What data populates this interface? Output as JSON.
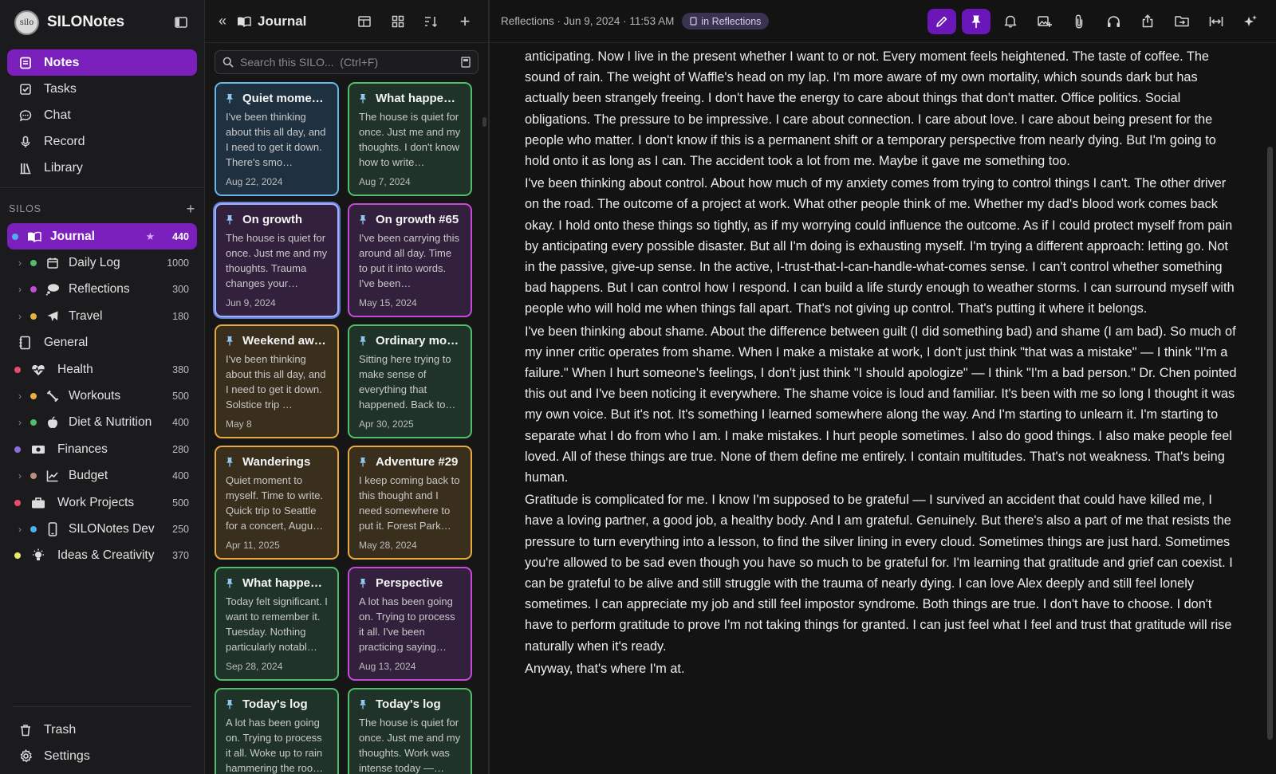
{
  "app": {
    "name": "SILONotes",
    "logo_text": "silo"
  },
  "nav": {
    "items": [
      {
        "label": "Notes",
        "icon": "notes-icon"
      },
      {
        "label": "Tasks",
        "icon": "checkbox-icon"
      },
      {
        "label": "Chat",
        "icon": "chat-icon"
      },
      {
        "label": "Record",
        "icon": "mic-icon"
      },
      {
        "label": "Library",
        "icon": "library-icon"
      }
    ]
  },
  "silos": {
    "heading": "SILOS",
    "items": [
      {
        "name": "Journal",
        "count": "440",
        "dot": "#4ab0f0",
        "icon": "book-icon",
        "starred": true,
        "child": false
      },
      {
        "name": "Daily Log",
        "count": "1000",
        "dot": "#4fbd6b",
        "icon": "calendar-icon",
        "child": true
      },
      {
        "name": "Reflections",
        "count": "300",
        "dot": "#c64ad8",
        "icon": "thought-icon",
        "child": true
      },
      {
        "name": "Travel",
        "count": "180",
        "dot": "#e8b040",
        "icon": "plane-icon",
        "child": true
      },
      {
        "name": "General",
        "count": "",
        "dot": "",
        "icon": "notebook-icon",
        "child": false
      },
      {
        "name": "Health",
        "count": "380",
        "dot": "#e64c6a",
        "icon": "heartbeat-icon",
        "child": false
      },
      {
        "name": "Workouts",
        "count": "500",
        "dot": "#e8b040",
        "icon": "dumbbell-icon",
        "child": true
      },
      {
        "name": "Diet & Nutrition",
        "count": "400",
        "dot": "#4fbd6b",
        "icon": "apple-icon",
        "child": true
      },
      {
        "name": "Finances",
        "count": "280",
        "dot": "#8a6ee0",
        "icon": "money-icon",
        "child": false
      },
      {
        "name": "Budget",
        "count": "400",
        "dot": "#b8927e",
        "icon": "chart-line-icon",
        "child": true
      },
      {
        "name": "Work Projects",
        "count": "500",
        "dot": "#e64c6a",
        "icon": "briefcase-icon",
        "child": false
      },
      {
        "name": "SILONotes Dev",
        "count": "250",
        "dot": "#4ab0f0",
        "icon": "phone-icon",
        "child": true
      },
      {
        "name": "Ideas & Creativity",
        "count": "370",
        "dot": "#e8e86a",
        "icon": "bulb-icon",
        "child": false
      }
    ]
  },
  "footer": {
    "trash": "Trash",
    "settings": "Settings"
  },
  "list": {
    "title": "Journal",
    "search_placeholder": "Search this SILO...  (Ctrl+F)",
    "cards": [
      {
        "title": "Quiet mome…",
        "body": "I've been thinking about this all day, and I need to get it down. There's smo…",
        "date": "Aug 22, 2024",
        "color": "blue"
      },
      {
        "title": "What happen…",
        "body": "The house is quiet for once. Just me and my thoughts. I don't know how to write…",
        "date": "Aug 7, 2024",
        "color": "green"
      },
      {
        "title": "On growth",
        "body": "The house is quiet for once. Just me and my thoughts. Trauma changes your…",
        "date": "Jun 9, 2024",
        "color": "selected"
      },
      {
        "title": "On growth #65",
        "body": "I've been carrying this around all day. Time to put it into words. I've been…",
        "date": "May 15, 2024",
        "color": "purple"
      },
      {
        "title": "Weekend aw…",
        "body": "I've been thinking about this all day, and I need to get it down. Solstice trip …",
        "date": "May 8",
        "color": "orange"
      },
      {
        "title": "Ordinary mo…",
        "body": "Sitting here trying to make sense of everything that happened. Back to…",
        "date": "Apr 30, 2025",
        "color": "green"
      },
      {
        "title": "Wanderings",
        "body": "Quiet moment to myself. Time to write. Quick trip to Seattle for a concert, Augu…",
        "date": "Apr 11, 2025",
        "color": "orange"
      },
      {
        "title": "Adventure #29",
        "body": "I keep coming back to this thought and I need somewhere to put it. Forest Park…",
        "date": "May 28, 2024",
        "color": "orange"
      },
      {
        "title": "What happen…",
        "body": "Today felt significant. I want to remember it. Tuesday. Nothing particularly notabl…",
        "date": "Sep 28, 2024",
        "color": "green"
      },
      {
        "title": "Perspective",
        "body": "A lot has been going on. Trying to process it all. I've been practicing saying…",
        "date": "Aug 13, 2024",
        "color": "purple"
      },
      {
        "title": "Today's log",
        "body": "A lot has been going on. Trying to process it all. Woke up to rain hammering the roo…",
        "date": "",
        "color": "green"
      },
      {
        "title": "Today's log",
        "body": "The house is quiet for once. Just me and my thoughts. Work was intense today —…",
        "date": "",
        "color": "green"
      }
    ]
  },
  "editor": {
    "meta": "Reflections · Jun 9, 2024 · 11:53 AM",
    "tag": "in Reflections",
    "paragraphs": [
      "anticipating. Now I live in the present whether I want to or not. Every moment feels heightened. The taste of coffee. The sound of rain. The weight of Waffle's head on my lap. I'm more aware of my own mortality, which sounds dark but has actually been strangely freeing. I don't have the energy to care about things that don't matter. Office politics. Social obligations. The pressure to be impressive. I care about connection. I care about love. I care about being present for the people who matter. I don't know if this is a permanent shift or a temporary perspective from nearly dying. But I'm going to hold onto it as long as I can. The accident took a lot from me. Maybe it gave me something too.",
      "I've been thinking about control. About how much of my anxiety comes from trying to control things I can't. The other driver on the road. The outcome of a project at work. What other people think of me. Whether my dad's blood work comes back okay. I hold onto these things so tightly, as if my worrying could influence the outcome. As if I could protect myself from pain by anticipating every possible disaster. But all I'm doing is exhausting myself. I'm trying a different approach: letting go. Not in the passive, give-up sense. In the active, I-trust-that-I-can-handle-what-comes sense. I can't control whether something bad happens. But I can control how I respond. I can build a life sturdy enough to weather storms. I can surround myself with people who will hold me when things fall apart. That's not giving up control. That's putting it where it belongs.",
      "I've been thinking about shame. About the difference between guilt (I did something bad) and shame (I am bad). So much of my inner critic operates from shame. When I make a mistake at work, I don't just think \"that was a mistake\" — I think \"I'm a failure.\" When I hurt someone's feelings, I don't just think \"I should apologize\" — I think \"I'm a bad person.\" Dr. Chen pointed this out and I've been noticing it everywhere. The shame voice is loud and familiar. It's been with me so long I thought it was my own voice. But it's not. It's something I learned somewhere along the way. And I'm starting to unlearn it. I'm starting to separate what I do from who I am. I make mistakes. I hurt people sometimes. I also do good things. I also make people feel loved. All of these things are true. None of them define me entirely. I contain multitudes. That's not weakness. That's being human.",
      "Gratitude is complicated for me. I know I'm supposed to be grateful — I survived an accident that could have killed me, I have a loving partner, a good job, a healthy body. And I am grateful. Genuinely. But there's also a part of me that resists the pressure to turn everything into a lesson, to find the silver lining in every cloud. Sometimes things are just hard. Sometimes you're allowed to be sad even though you have so much to be grateful for. I'm learning that gratitude and grief can coexist. I can be grateful to be alive and still struggle with the trauma of nearly dying. I can love Alex deeply and still feel lonely sometimes. I can appreciate my job and still feel impostor syndrome. Both things are true. I don't have to choose. I don't have to perform gratitude to prove I'm not taking things for granted. I can just feel what I feel and trust that gratitude will rise naturally when it's ready.",
      "Anyway, that's where I'm at."
    ]
  },
  "colors": {
    "accent": "#7b1fbd",
    "card_blue": "#66b6ea",
    "card_green": "#4fbd6b",
    "card_purple": "#c64ad8",
    "card_orange": "#e8a840"
  }
}
